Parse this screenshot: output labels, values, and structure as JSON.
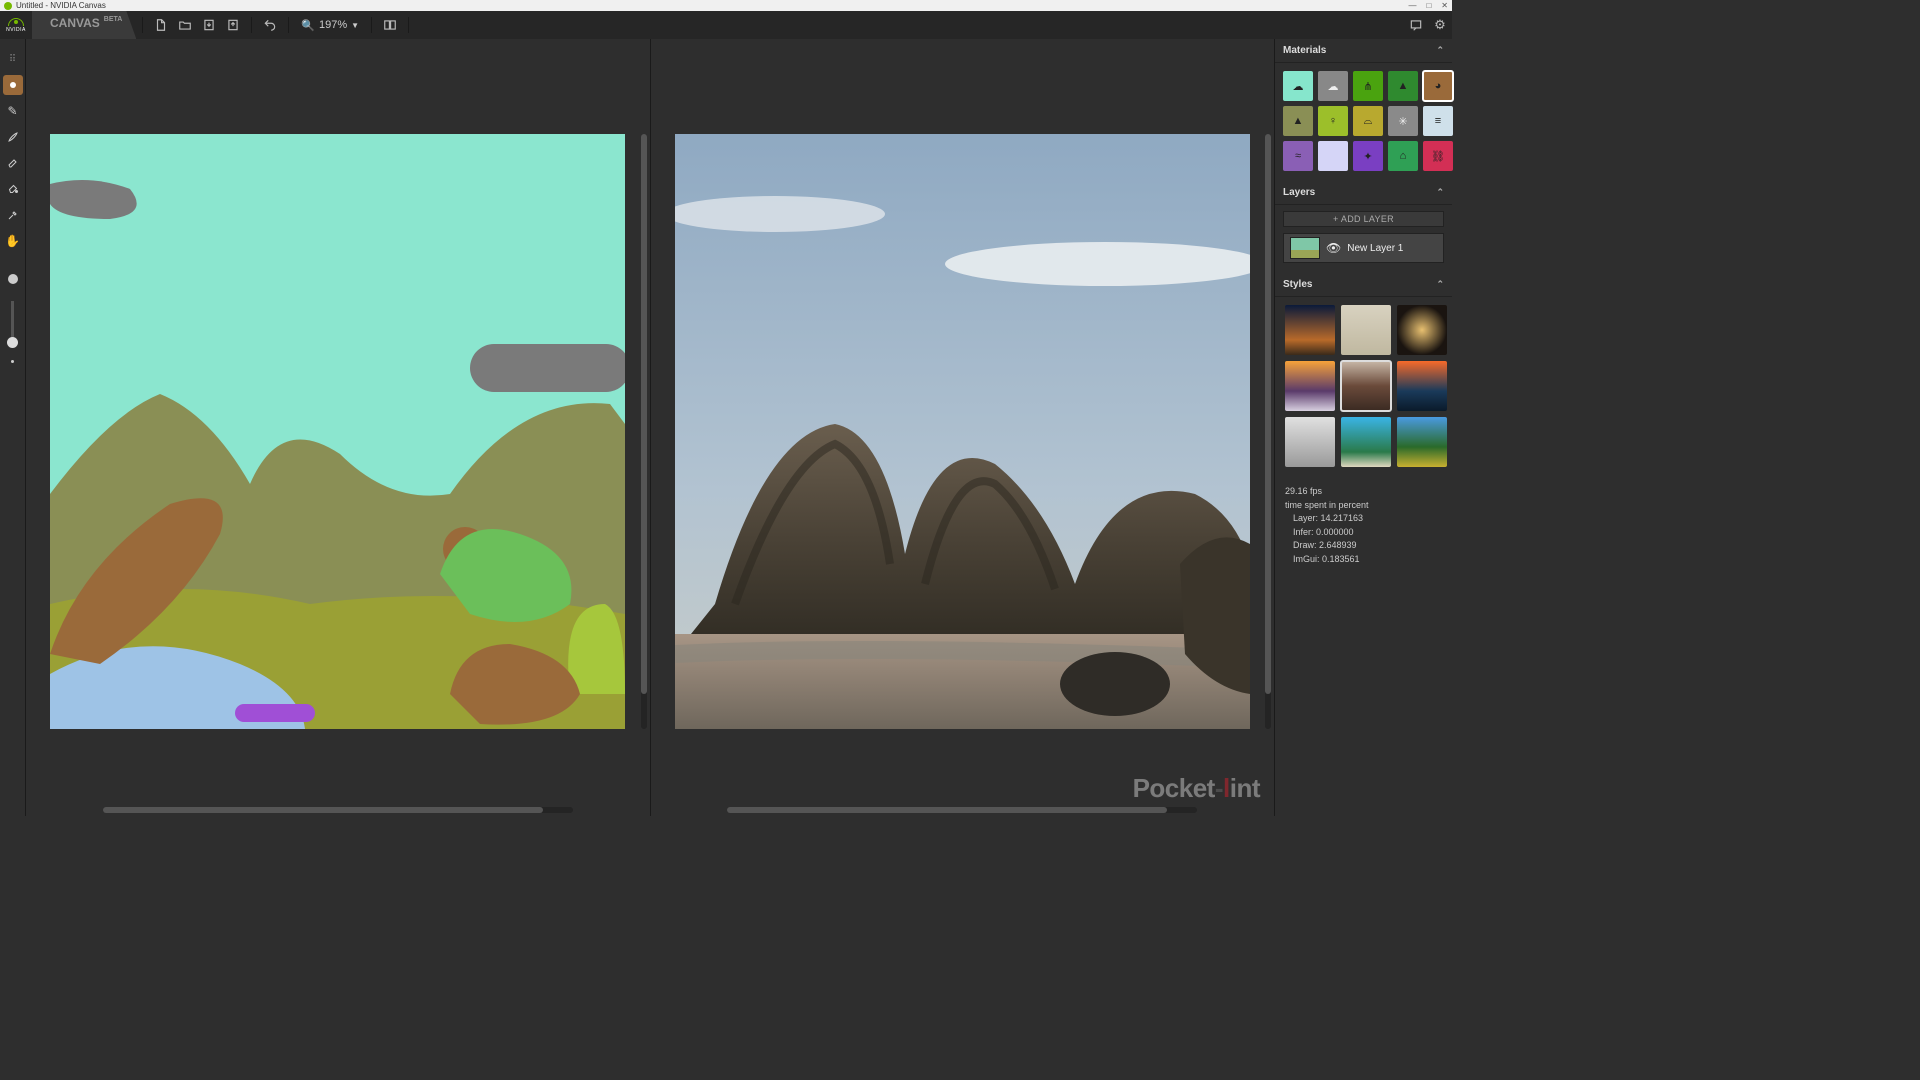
{
  "window": {
    "title": "Untitled - NVIDIA Canvas"
  },
  "brand": {
    "name": "CANVAS",
    "tag": "BETA",
    "vendor": "NVIDIA"
  },
  "toolbar_top": {
    "zoom": "197%"
  },
  "panels": {
    "materials": {
      "title": "Materials",
      "items": [
        {
          "name": "sky",
          "color": "#86e6cc",
          "selected": false
        },
        {
          "name": "cloud",
          "color": "#888888",
          "selected": false
        },
        {
          "name": "grass",
          "color": "#4aa30f",
          "selected": false
        },
        {
          "name": "hill",
          "color": "#2f8a2f",
          "selected": false
        },
        {
          "name": "dirt",
          "color": "#9a6a3a",
          "selected": true
        },
        {
          "name": "mountain",
          "color": "#8a8f55",
          "selected": false
        },
        {
          "name": "tree",
          "color": "#9cbf2a",
          "selected": false
        },
        {
          "name": "sand",
          "color": "#b8a92f",
          "selected": false
        },
        {
          "name": "rock",
          "color": "#8a8a8a",
          "selected": false
        },
        {
          "name": "fog",
          "color": "#cfe0ea",
          "selected": false
        },
        {
          "name": "sea",
          "color": "#8a5fb5",
          "selected": false
        },
        {
          "name": "snow",
          "color": "#d5d5f7",
          "selected": false
        },
        {
          "name": "flower",
          "color": "#7a3fc2",
          "selected": false
        },
        {
          "name": "bush",
          "color": "#2fa055",
          "selected": false
        },
        {
          "name": "building",
          "color": "#d32f55",
          "selected": false
        }
      ]
    },
    "layers": {
      "title": "Layers",
      "add_label": "+ ADD LAYER",
      "items": [
        {
          "name": "New Layer 1",
          "visible": true
        }
      ]
    },
    "styles": {
      "title": "Styles",
      "selected_index": 4
    },
    "stats": {
      "fps": "29.16 fps",
      "heading": "time spent in percent",
      "layer": "Layer: 14.217163",
      "infer": "Infer: 0.000000",
      "draw": "Draw: 2.648939",
      "imgui": "ImGui: 0.183561"
    }
  },
  "watermark": {
    "a": "Pocket",
    "b": "l",
    "c": "int"
  }
}
